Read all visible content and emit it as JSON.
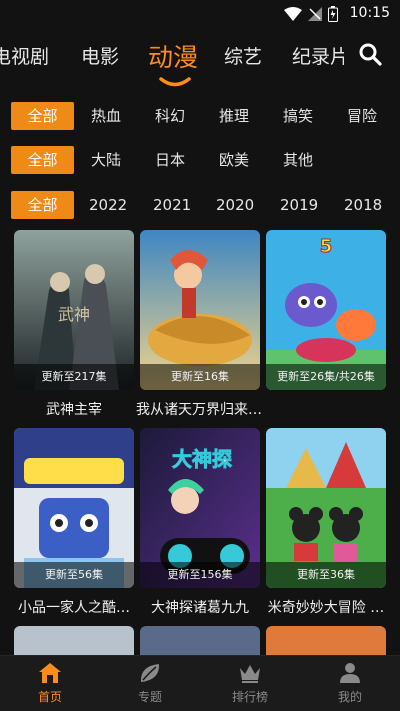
{
  "status_bar": {
    "time": "10:15"
  },
  "top_tabs": [
    {
      "label": "电视剧",
      "active": false
    },
    {
      "label": "电影",
      "active": false
    },
    {
      "label": "动漫",
      "active": true
    },
    {
      "label": "综艺",
      "active": false
    },
    {
      "label": "纪录片",
      "active": false
    }
  ],
  "filters": {
    "genre": [
      "全部",
      "热血",
      "科幻",
      "推理",
      "搞笑",
      "冒险"
    ],
    "region": [
      "全部",
      "大陆",
      "日本",
      "欧美",
      "其他"
    ],
    "year": [
      "全部",
      "2022",
      "2021",
      "2020",
      "2019",
      "2018"
    ]
  },
  "items": [
    {
      "title": "武神主宰",
      "badge": "更新至217集",
      "colors": [
        "#3b4a4a",
        "#7d8c88",
        "#2a2f33"
      ]
    },
    {
      "title": "我从诸天万界归来猪猪侠之恐龙日…",
      "badge": "更新至16集",
      "colors": [
        "#2a5d87",
        "#e8b54d",
        "#c25a3a"
      ]
    },
    {
      "title": "",
      "badge": "更新至26集/共26集",
      "colors": [
        "#3db0e6",
        "#ffde4a",
        "#d6345a"
      ]
    },
    {
      "title": "小品一家人之酷…",
      "badge": "更新至56集",
      "colors": [
        "#2f3f8a",
        "#8cc6f0",
        "#e6e6f0"
      ]
    },
    {
      "title": "大神探诸葛九九",
      "badge": "更新至156集",
      "colors": [
        "#1c1a3a",
        "#5a2f8c",
        "#35c9d9"
      ]
    },
    {
      "title": "米奇妙妙大冒险 …",
      "badge": "更新至36集",
      "colors": [
        "#4caf4a",
        "#8fd2f0",
        "#d63a3a"
      ]
    }
  ],
  "bottom_nav": [
    {
      "label": "首页",
      "icon": "home-icon",
      "active": true
    },
    {
      "label": "专题",
      "icon": "leaf-icon",
      "active": false
    },
    {
      "label": "排行榜",
      "icon": "crown-icon",
      "active": false
    },
    {
      "label": "我的",
      "icon": "user-icon",
      "active": false
    }
  ],
  "accent_color": "#f08a17"
}
